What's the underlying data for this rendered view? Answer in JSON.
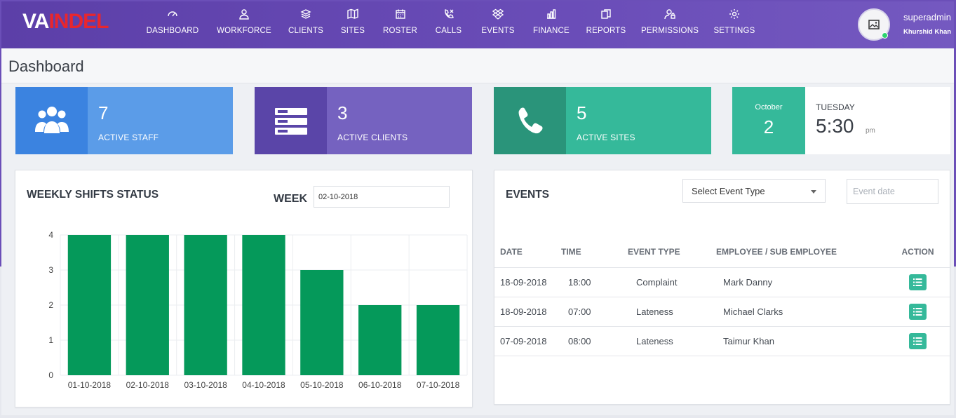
{
  "brand": {
    "part1": "VA",
    "part2": "INDEL"
  },
  "nav": [
    {
      "label": "DASHBOARD",
      "icon": "gauge-icon"
    },
    {
      "label": "WORKFORCE",
      "icon": "user-icon"
    },
    {
      "label": "CLIENTS",
      "icon": "layers-icon"
    },
    {
      "label": "SITES",
      "icon": "map-icon"
    },
    {
      "label": "ROSTER",
      "icon": "calendar-icon"
    },
    {
      "label": "CALLS",
      "icon": "phone-call-icon"
    },
    {
      "label": "EVENTS",
      "icon": "dropbox-icon"
    },
    {
      "label": "FINANCE",
      "icon": "bar-chart-icon"
    },
    {
      "label": "REPORTS",
      "icon": "copy-icon"
    },
    {
      "label": "PERMISSIONS",
      "icon": "user-lock-icon"
    },
    {
      "label": "SETTINGS",
      "icon": "gear-icon"
    }
  ],
  "user": {
    "name": "superadmin",
    "full_name": "Khurshid Khan"
  },
  "page": {
    "title": "Dashboard"
  },
  "stats": [
    {
      "count": "7",
      "label": "ACTIVE STAFF",
      "color": "#5b9ce8",
      "icon_bg": "#3b83e0",
      "icon": "users-icon"
    },
    {
      "count": "3",
      "label": "ACTIVE CLIENTS",
      "color": "#7562c0",
      "icon_bg": "#5a45a8",
      "icon": "server-icon"
    },
    {
      "count": "5",
      "label": "ACTIVE SITES",
      "color": "#35b99a",
      "icon_bg": "#2a947a",
      "icon": "phone-icon"
    }
  ],
  "date_card": {
    "month": "October",
    "day": "2",
    "weekday": "TUESDAY",
    "time": "5:30",
    "ampm": "pm"
  },
  "shifts": {
    "title": "WEEKLY SHIFTS STATUS",
    "week_label": "WEEK",
    "week_value": "02-10-2018"
  },
  "chart_data": {
    "type": "bar",
    "categories": [
      "01-10-2018",
      "02-10-2018",
      "03-10-2018",
      "04-10-2018",
      "05-10-2018",
      "06-10-2018",
      "07-10-2018"
    ],
    "values": [
      4,
      4,
      4,
      4,
      3,
      2,
      2
    ],
    "ylim": [
      0,
      4
    ],
    "yticks": [
      "0",
      "1",
      "2",
      "3",
      "4"
    ],
    "grid": true,
    "bar_color": "#05995a"
  },
  "events": {
    "title": "EVENTS",
    "select_placeholder": "Select Event Type",
    "date_placeholder": "Event date",
    "columns": [
      "DATE",
      "TIME",
      "EVENT TYPE",
      "EMPLOYEE / SUB EMPLOYEE",
      "ACTION"
    ],
    "rows": [
      {
        "date": "18-09-2018",
        "time": "18:00",
        "type": "Complaint",
        "employee": "Mark Danny"
      },
      {
        "date": "18-09-2018",
        "time": "07:00",
        "type": "Lateness",
        "employee": "Michael Clarks"
      },
      {
        "date": "07-09-2018",
        "time": "08:00",
        "type": "Lateness",
        "employee": "Taimur Khan"
      }
    ]
  }
}
